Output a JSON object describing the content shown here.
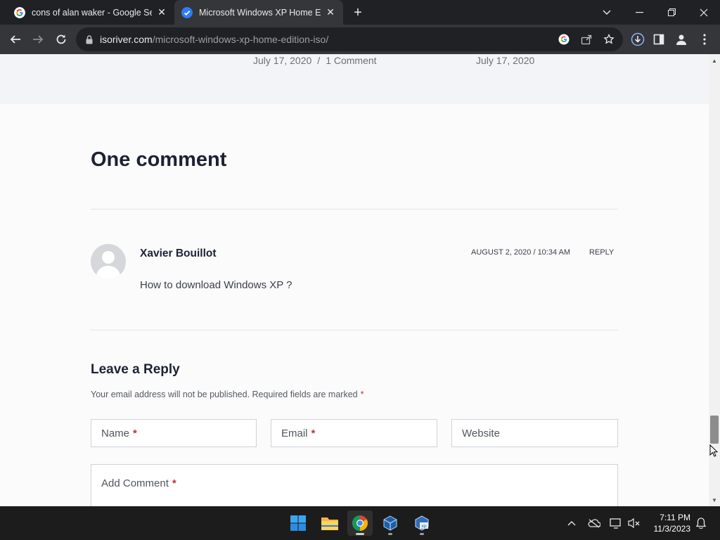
{
  "browser": {
    "tabs": [
      {
        "title": "cons of alan waker - Google Sea",
        "favicon": "google-icon",
        "active": false
      },
      {
        "title": "Microsoft Windows XP Home Ed",
        "favicon": "isoriver-icon",
        "active": true
      }
    ],
    "new_tab": "+",
    "address": {
      "host": "isoriver.com",
      "path": "/microsoft-windows-xp-home-edition-iso/"
    }
  },
  "page": {
    "related_meta": [
      {
        "date": "July 17, 2020",
        "separator": "/",
        "comments": "1 Comment"
      },
      {
        "date": "July 17, 2020"
      }
    ],
    "comments_heading": "One comment",
    "comment": {
      "author": "Xavier Bouillot",
      "date": "AUGUST 2, 2020 / 10:34 AM",
      "reply": "REPLY",
      "text": "How to download Windows XP ?"
    },
    "reply_form": {
      "heading": "Leave a Reply",
      "note": "Your email address will not be published. Required fields are marked",
      "required_mark": "*",
      "fields": [
        {
          "label": "Name",
          "required": true
        },
        {
          "label": "Email",
          "required": true
        },
        {
          "label": "Website",
          "required": false
        }
      ],
      "comment_field": {
        "label": "Add Comment",
        "required": true
      }
    }
  },
  "taskbar": {
    "apps": [
      "start-icon",
      "file-explorer-icon",
      "chrome-icon",
      "virtualbox-icon",
      "windows-xp-vm-icon"
    ],
    "clock": {
      "time": "7:11 PM",
      "date": "11/3/2023"
    }
  },
  "colors": {
    "required": "#c2303a",
    "heading": "#1c2233",
    "tabbar": "#202124",
    "toolbar": "#35363a"
  }
}
